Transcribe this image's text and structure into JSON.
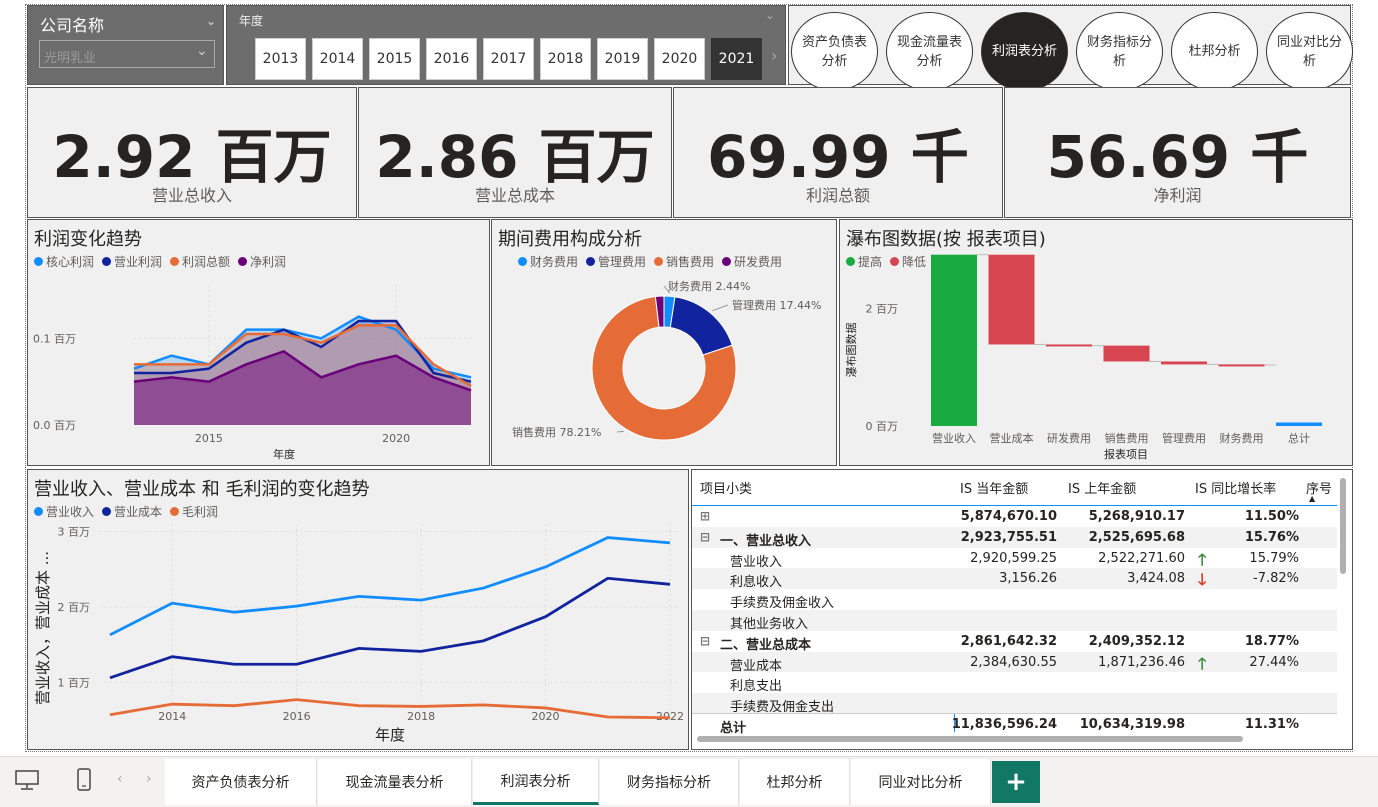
{
  "filters": {
    "company_label": "公司名称",
    "company_value": "光明乳业",
    "year_label": "年度",
    "years": [
      "2013",
      "2014",
      "2015",
      "2016",
      "2017",
      "2018",
      "2019",
      "2020",
      "2021"
    ],
    "selected_year": "2021"
  },
  "nav_buttons": [
    "资产负债表分析",
    "现金流量表分析",
    "利润表分析",
    "财务指标分析",
    "杜邦分析",
    "同业对比分析"
  ],
  "nav_selected": "利润表分析",
  "kpis": [
    {
      "value": "2.92 百万",
      "label": "营业总收入"
    },
    {
      "value": "2.86 百万",
      "label": "营业总成本"
    },
    {
      "value": "69.99 千",
      "label": "利润总额"
    },
    {
      "value": "56.69 千",
      "label": "净利润"
    }
  ],
  "colors": {
    "light_blue": "#118DFF",
    "dark_blue": "#12239E",
    "orange": "#E66C37",
    "purple": "#6B007B",
    "green": "#1AAB40",
    "red": "#D64550"
  },
  "chart_data": [
    {
      "type": "area",
      "title": "利润变化趋势",
      "xlabel": "年度",
      "ylabel": "",
      "x": [
        2013,
        2014,
        2015,
        2016,
        2017,
        2018,
        2019,
        2020,
        2021,
        2022
      ],
      "xticks": [
        "2015",
        "2020"
      ],
      "yticks": [
        "0.0 百万",
        "0.1 百万"
      ],
      "ylim": [
        0,
        0.15
      ],
      "series": [
        {
          "name": "核心利润",
          "values": [
            0.065,
            0.08,
            0.07,
            0.11,
            0.11,
            0.1,
            0.125,
            0.11,
            0.065,
            0.055
          ]
        },
        {
          "name": "营业利润",
          "values": [
            0.06,
            0.06,
            0.065,
            0.095,
            0.11,
            0.09,
            0.12,
            0.12,
            0.06,
            0.05
          ]
        },
        {
          "name": "利润总额",
          "values": [
            0.07,
            0.07,
            0.07,
            0.105,
            0.105,
            0.095,
            0.115,
            0.115,
            0.07,
            0.045
          ]
        },
        {
          "name": "净利润",
          "values": [
            0.05,
            0.055,
            0.05,
            0.07,
            0.085,
            0.055,
            0.07,
            0.08,
            0.055,
            0.04
          ]
        }
      ]
    },
    {
      "type": "pie",
      "title": "期间费用构成分析",
      "categories": [
        "财务费用",
        "管理费用",
        "销售费用",
        "研发费用"
      ],
      "values": [
        2.44,
        17.44,
        78.21,
        1.91
      ],
      "labels": [
        "财务费用 2.44%",
        "管理费用 17.44%",
        "销售费用 78.21%"
      ]
    },
    {
      "type": "bar",
      "title": "瀑布图数据(按 报表项目)",
      "legend": [
        "提高",
        "降低",
        "总计"
      ],
      "xlabel": "报表项目",
      "ylabel": "瀑布图数据",
      "categories": [
        "营业收入",
        "营业成本",
        "研发费用",
        "销售费用",
        "管理费用",
        "财务费用",
        "总计"
      ],
      "start": [
        0,
        2.92,
        1.39,
        1.37,
        1.1,
        1.05,
        0
      ],
      "end": [
        2.92,
        1.39,
        1.37,
        1.1,
        1.05,
        1.04,
        0.06
      ],
      "kind": [
        "提高",
        "降低",
        "降低",
        "降低",
        "降低",
        "降低",
        "总计"
      ],
      "yticks": [
        "0 百万",
        "2 百万"
      ],
      "ylim": [
        0,
        3
      ]
    },
    {
      "type": "line",
      "title": "营业收入、营业成本 和 毛利润的变化趋势",
      "xlabel": "年度",
      "ylabel": "营业收入，营业成本 ...",
      "x": [
        2013,
        2014,
        2015,
        2016,
        2017,
        2018,
        2019,
        2020,
        2021,
        2022
      ],
      "xticks": [
        "2014",
        "2016",
        "2018",
        "2020",
        "2022"
      ],
      "yticks": [
        "1 百万",
        "2 百万",
        "3 百万"
      ],
      "ylim": [
        0.5,
        3.1
      ],
      "series": [
        {
          "name": "营业收入",
          "values": [
            1.63,
            2.05,
            1.93,
            2.01,
            2.14,
            2.09,
            2.25,
            2.53,
            2.92,
            2.85
          ]
        },
        {
          "name": "营业成本",
          "values": [
            1.06,
            1.34,
            1.24,
            1.24,
            1.45,
            1.41,
            1.55,
            1.87,
            2.38,
            2.3
          ]
        },
        {
          "name": "毛利润",
          "values": [
            0.57,
            0.71,
            0.69,
            0.77,
            0.69,
            0.68,
            0.7,
            0.66,
            0.54,
            0.53
          ]
        }
      ]
    }
  ],
  "table": {
    "headers": [
      "项目小类",
      "IS 当年金额",
      "IS 上年金额",
      "IS 同比增长率",
      "序号"
    ],
    "rows": [
      {
        "expand": "⊞",
        "name": "",
        "cur": "5,874,670.10",
        "prev": "5,268,910.17",
        "arrow": "",
        "rate": "11.50%",
        "bold": true,
        "indent": 0
      },
      {
        "expand": "⊟",
        "name": "一、营业总收入",
        "cur": "2,923,755.51",
        "prev": "2,525,695.68",
        "arrow": "",
        "rate": "15.76%",
        "bold": true,
        "indent": 0
      },
      {
        "expand": "",
        "name": "营业收入",
        "cur": "2,920,599.25",
        "prev": "2,522,271.60",
        "arrow": "up",
        "rate": "15.79%",
        "bold": false,
        "indent": 1
      },
      {
        "expand": "",
        "name": "利息收入",
        "cur": "3,156.26",
        "prev": "3,424.08",
        "arrow": "down",
        "rate": "-7.82%",
        "bold": false,
        "indent": 1
      },
      {
        "expand": "",
        "name": "手续费及佣金收入",
        "cur": "",
        "prev": "",
        "arrow": "",
        "rate": "",
        "bold": false,
        "indent": 1
      },
      {
        "expand": "",
        "name": "其他业务收入",
        "cur": "",
        "prev": "",
        "arrow": "",
        "rate": "",
        "bold": false,
        "indent": 1
      },
      {
        "expand": "⊟",
        "name": "二、营业总成本",
        "cur": "2,861,642.32",
        "prev": "2,409,352.12",
        "arrow": "",
        "rate": "18.77%",
        "bold": true,
        "indent": 0
      },
      {
        "expand": "",
        "name": "营业成本",
        "cur": "2,384,630.55",
        "prev": "1,871,236.46",
        "arrow": "up",
        "rate": "27.44%",
        "bold": false,
        "indent": 1
      },
      {
        "expand": "",
        "name": "利息支出",
        "cur": "",
        "prev": "",
        "arrow": "",
        "rate": "",
        "bold": false,
        "indent": 1
      },
      {
        "expand": "",
        "name": "手续费及佣金支出",
        "cur": "",
        "prev": "",
        "arrow": "",
        "rate": "",
        "bold": false,
        "indent": 1
      }
    ],
    "total": {
      "name": "总计",
      "cur": "11,836,596.24",
      "prev": "10,634,319.98",
      "rate": "11.31%"
    }
  },
  "tabs": [
    "资产负债表分析",
    "现金流量表分析",
    "利润表分析",
    "财务指标分析",
    "杜邦分析",
    "同业对比分析"
  ],
  "tab_selected": "利润表分析",
  "add_label": "+"
}
